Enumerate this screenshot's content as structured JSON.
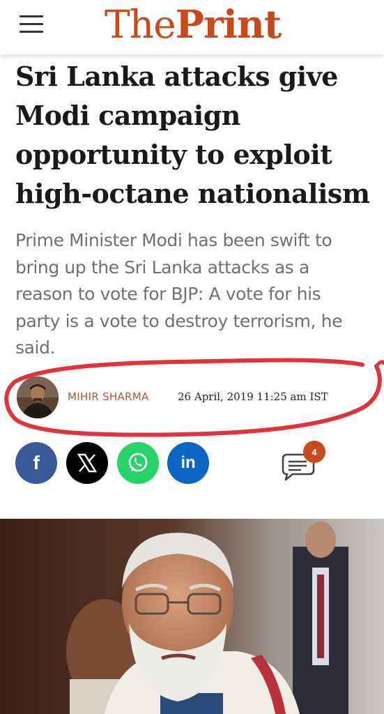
{
  "header": {
    "logo_the": "The",
    "logo_print": "Print",
    "menu_icon": "hamburger-icon",
    "accent_color": "#c84a1c"
  },
  "article": {
    "headline_lines": [
      "Sri Lanka attacks give",
      "Modi campaign",
      "opportunity to exploit",
      "high-octane nationalism"
    ],
    "standfirst_lines": [
      "Prime Minister Modi has been swift to",
      "bring up the Sri Lanka attacks as a",
      "reason to vote for BJP: A vote for his",
      "party is a vote to destroy terrorism, he",
      "said."
    ],
    "author": "MIHIR SHARMA",
    "date": "26 April, 2019 11:25 am IST"
  },
  "share": {
    "facebook_glyph": "f",
    "linkedin_glyph": "in",
    "icons": [
      "facebook-icon",
      "x-icon",
      "whatsapp-icon",
      "linkedin-icon",
      "comment-icon"
    ],
    "colors": {
      "facebook": "#3b5998",
      "x": "#000000",
      "whatsapp": "#25d366",
      "linkedin": "#0a66c2"
    }
  },
  "comments": {
    "count": "4"
  },
  "annotation": {
    "marker_color": "#e0333d"
  }
}
